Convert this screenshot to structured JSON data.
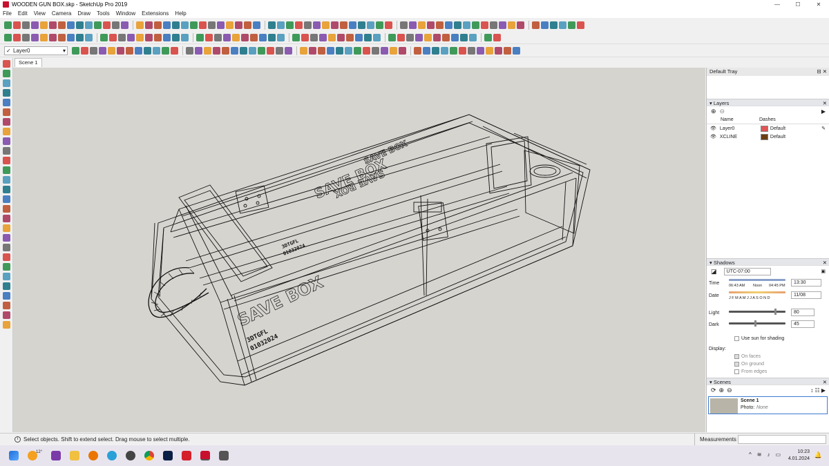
{
  "window": {
    "title": "WOODEN GUN BOX.skp - SketchUp Pro 2019",
    "minimize": "—",
    "maximize": "☐",
    "close": "✕"
  },
  "menu": [
    "File",
    "Edit",
    "View",
    "Camera",
    "Draw",
    "Tools",
    "Window",
    "Extensions",
    "Help"
  ],
  "layer_toolbar": {
    "current_layer": "Layer0"
  },
  "scene_tabs": [
    "Scene 1"
  ],
  "model_labels": {
    "lid_text_1": "SAVE BOX",
    "lid_text_2": "SAVE BOX",
    "lid_text_3": "SAVE BOX",
    "side_text": "SAVE BOX",
    "code_1": "3DTGFL",
    "code_2": "01032024"
  },
  "tray": {
    "title": "Default Tray",
    "layers": {
      "title": "Layers",
      "col_name": "Name",
      "col_dashes": "Dashes",
      "rows": [
        {
          "name": "Layer0",
          "color": "#e05555",
          "dashes": "Default"
        },
        {
          "name": "XCLINE",
          "color": "#6b3e12",
          "dashes": "Default"
        }
      ]
    },
    "shadows": {
      "title": "Shadows",
      "timezone": "UTC-07:00",
      "time_label": "Time",
      "time_start": "06:43 AM",
      "time_noon": "Noon",
      "time_end": "04:45 PM",
      "time_value": "13:30",
      "date_label": "Date",
      "months": "J F M A M J J A S O N D",
      "date_value": "11/08",
      "light_label": "Light",
      "light_value": "80",
      "light_level": 0.8,
      "dark_label": "Dark",
      "dark_value": "45",
      "dark_level": 0.45,
      "use_sun": "Use sun for shading",
      "display_label": "Display:",
      "on_faces": "On faces",
      "on_ground": "On ground",
      "from_edges": "From edges"
    },
    "scenes": {
      "title": "Scenes",
      "scene_name": "Scene 1",
      "photo_label": "Photo:",
      "photo_value": "None"
    }
  },
  "status": {
    "message": "Select objects. Shift to extend select. Drag mouse to select multiple.",
    "measurements_label": "Measurements"
  },
  "taskbar": {
    "weather": "12°",
    "time": "10:23",
    "date": "4.01.2024"
  },
  "colors": {
    "viewport_bg": "#d6d4cf",
    "panel_header": "#e4e6ea",
    "taskbar_bg": "#e8e4ee",
    "app_red": "#c8102e"
  }
}
